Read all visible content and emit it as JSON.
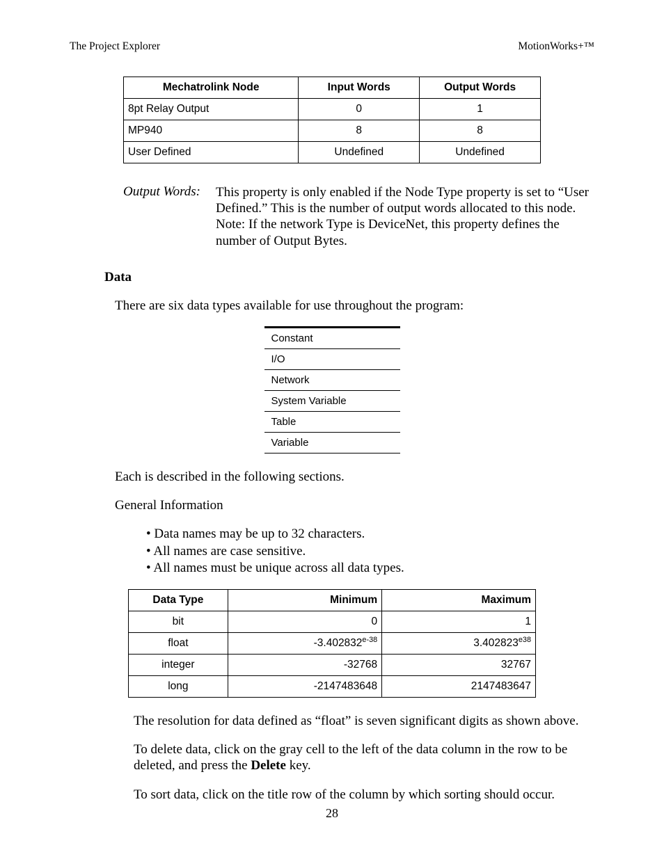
{
  "header": {
    "left": "The Project Explorer",
    "right": "MotionWorks+™"
  },
  "table1": {
    "headers": [
      "Mechatrolink Node",
      "Input Words",
      "Output Words"
    ],
    "rows": [
      {
        "node": "8pt Relay Output",
        "in": "0",
        "out": "1"
      },
      {
        "node": "MP940",
        "in": "8",
        "out": "8"
      },
      {
        "node": "User Defined",
        "in": "Undefined",
        "out": "Undefined"
      }
    ]
  },
  "def": {
    "term": "Output Words:",
    "body": "This property is only enabled if the Node Type property is set to “User Defined.”  This is the number of output words allocated to this node.  Note:  If the network Type is DeviceNet, this property defines the number of Output Bytes."
  },
  "section_heading": "Data",
  "intro_para": "There are six data types available for use throughout the program:",
  "datatypes_list": [
    "Constant",
    "I/O",
    "Network",
    "System Variable",
    "Table",
    "Variable"
  ],
  "after_list_para": "Each is described in the following sections.",
  "general_info_heading": "General Information",
  "bullets": [
    "Data names may be up to 32 characters.",
    "All names are case sensitive.",
    "All names must be unique across all data types."
  ],
  "table3": {
    "headers": [
      "Data Type",
      "Minimum",
      "Maximum"
    ],
    "rows": [
      {
        "type": "bit",
        "min": "0",
        "min_sup": "",
        "max": "1",
        "max_sup": ""
      },
      {
        "type": "float",
        "min": "-3.402832",
        "min_sup": "e-38",
        "max": "3.402823",
        "max_sup": "e38"
      },
      {
        "type": "integer",
        "min": "-32768",
        "min_sup": "",
        "max": "32767",
        "max_sup": ""
      },
      {
        "type": "long",
        "min": "-2147483648",
        "min_sup": "",
        "max": "2147483647",
        "max_sup": ""
      }
    ]
  },
  "paras_after": [
    "The resolution for data defined as “float” is seven significant digits as shown above.",
    "To delete data, click on the gray cell to the left of the data column in the row to be deleted, and press the ",
    "Delete",
    " key.",
    "To sort data, click on the title row of the column by which sorting should occur."
  ],
  "page_number": "28"
}
